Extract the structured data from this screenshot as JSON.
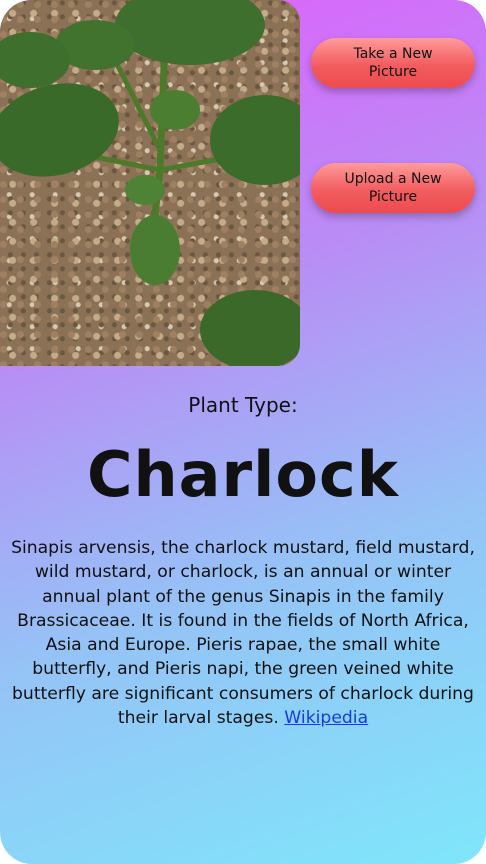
{
  "buttons": {
    "take_picture": "Take a New Picture",
    "upload_picture": "Upload a New Picture"
  },
  "result": {
    "label": "Plant Type:",
    "name": "Charlock",
    "description": "Sinapis arvensis, the charlock mustard, field mustard, wild mustard, or charlock, is an annual or winter annual plant of the genus Sinapis in the family Brassicaceae. It is found in the fields of North Africa, Asia and Europe. Pieris rapae, the small white butterfly, and Pieris napi, the green veined white butterfly are significant consumers of charlock during their larval stages.",
    "link_text": "Wikipedia"
  },
  "colors": {
    "gradient_top": "#e35cfd",
    "gradient_bottom": "#7fe6fb",
    "button": "#f25d5f",
    "link": "#1a3be0"
  }
}
